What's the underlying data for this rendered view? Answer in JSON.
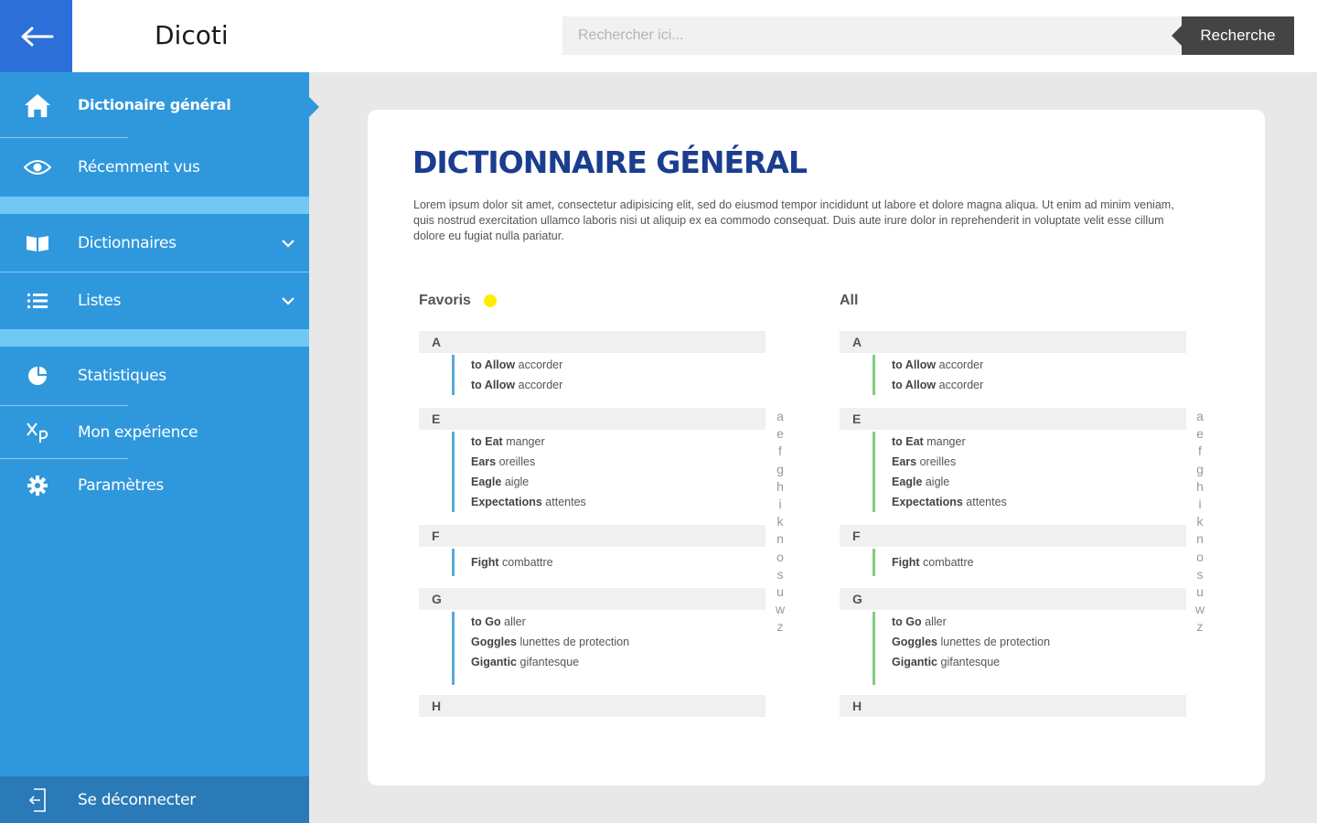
{
  "header": {
    "app_title": "Dicoti",
    "search_placeholder": "Rechercher ici...",
    "search_button": "Recherche"
  },
  "sidebar": {
    "items": [
      {
        "label": "Dictionaire général",
        "icon": "home-icon",
        "active": true
      },
      {
        "label": "Récemment vus",
        "icon": "eye-icon"
      },
      {
        "label": "Dictionnaires",
        "icon": "book-icon",
        "expandable": true
      },
      {
        "label": "Listes",
        "icon": "list-icon",
        "expandable": true
      },
      {
        "label": "Statistiques",
        "icon": "pie-chart-icon"
      },
      {
        "label": "Mon expérience",
        "icon": "xp-icon"
      },
      {
        "label": "Paramètres",
        "icon": "gear-icon"
      }
    ],
    "logout_label": "Se déconnecter"
  },
  "main": {
    "title": "DICTIONNAIRE GÉNÉRAL",
    "intro": "Lorem ipsum dolor sit amet, consectetur adipisicing elit, sed do eiusmod tempor incididunt ut labore et dolore magna aliqua. Ut enim ad minim veniam, quis nostrud exercitation ullamco laboris nisi ut aliquip ex ea commodo consequat. Duis aute irure dolor in reprehenderit in voluptate velit esse cillum dolore eu fugiat nulla pariatur.",
    "favorites_label": "Favoris",
    "all_label": "All",
    "sections": [
      {
        "letter": "A",
        "entries": [
          {
            "term": "to Allow",
            "translation": "accorder"
          },
          {
            "term": "to Allow",
            "translation": "accorder"
          }
        ]
      },
      {
        "letter": "E",
        "entries": [
          {
            "term": "to Eat",
            "translation": "manger"
          },
          {
            "term": "Ears",
            "translation": "oreilles"
          },
          {
            "term": "Eagle",
            "translation": "aigle"
          },
          {
            "term": "Expectations",
            "translation": "attentes"
          }
        ]
      },
      {
        "letter": "F",
        "entries": [
          {
            "term": "Fight",
            "translation": "combattre"
          }
        ]
      },
      {
        "letter": "G",
        "entries": [
          {
            "term": "to Go",
            "translation": "aller"
          },
          {
            "term": "Goggles",
            "translation": "lunettes de protection"
          },
          {
            "term": "Gigantic",
            "translation": "gifantesque"
          }
        ]
      },
      {
        "letter": "H",
        "entries": []
      }
    ],
    "alphabet_index": [
      "a",
      "e",
      "f",
      "g",
      "h",
      "i",
      "k",
      "n",
      "o",
      "s",
      "u",
      "w",
      "z"
    ],
    "colors": {
      "favorites_accent": "#5aa9dd",
      "all_accent": "#7dcf7d",
      "favorite_dot": "#ffee00"
    }
  }
}
